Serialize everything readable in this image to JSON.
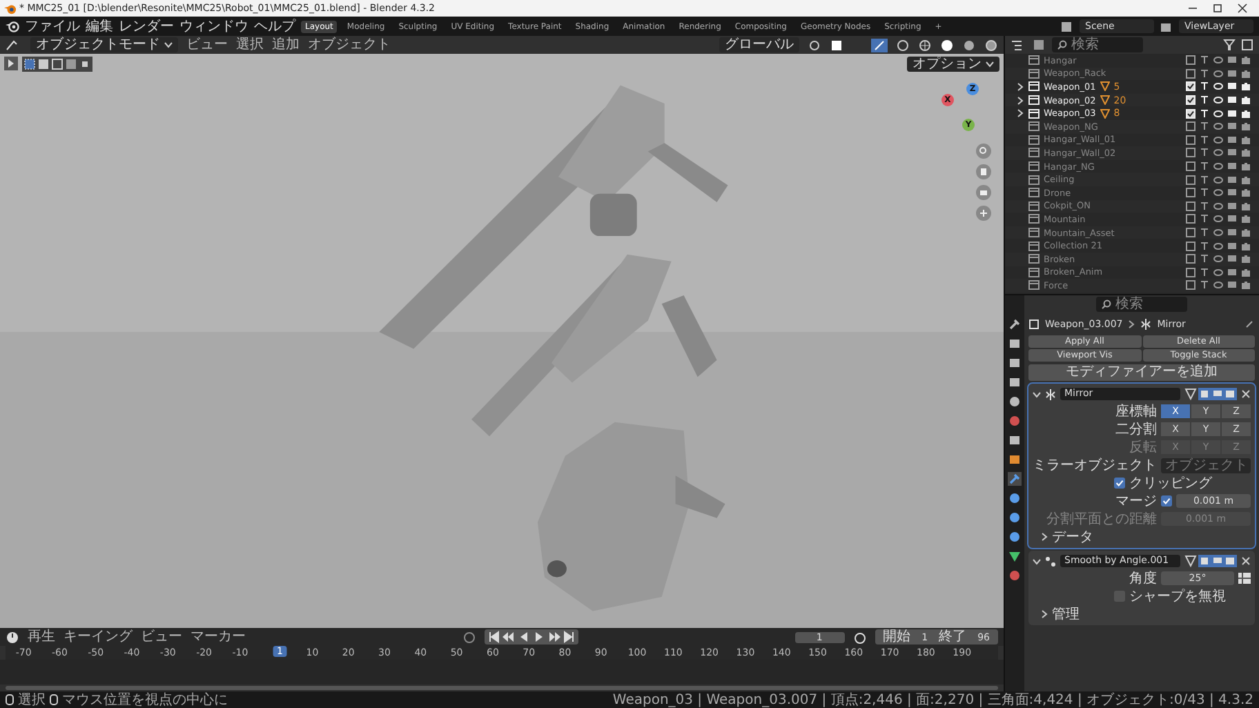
{
  "window": {
    "title": "* MMC25_01 [D:\\blender\\Resonite\\MMC25\\Robot_01\\MMC25_01.blend] - Blender 4.3.2"
  },
  "menu": [
    "ファイル",
    "編集",
    "レンダー",
    "ウィンドウ",
    "ヘルプ"
  ],
  "workspaces": [
    {
      "label": "Layout",
      "selected": true
    },
    {
      "label": "Modeling",
      "selected": false
    },
    {
      "label": "Sculpting",
      "selected": false
    },
    {
      "label": "UV Editing",
      "selected": false
    },
    {
      "label": "Texture Paint",
      "selected": false
    },
    {
      "label": "Shading",
      "selected": false
    },
    {
      "label": "Animation",
      "selected": false
    },
    {
      "label": "Rendering",
      "selected": false
    },
    {
      "label": "Compositing",
      "selected": false
    },
    {
      "label": "Geometry Nodes",
      "selected": false
    },
    {
      "label": "Scripting",
      "selected": false
    }
  ],
  "add_workspace": "+",
  "scene": "Scene",
  "view_layer": "ViewLayer",
  "viewport": {
    "mode": "オブジェクトモード",
    "menus": [
      "ビュー",
      "選択",
      "追加",
      "オブジェクト"
    ],
    "transform": "グローバル",
    "options": "オプション",
    "axes": [
      "X",
      "Y",
      "Z"
    ]
  },
  "outliner": {
    "search_placeholder": "検索",
    "items": [
      {
        "name": "Hangar",
        "enabled": false,
        "expandable": false
      },
      {
        "name": "Weapon_Rack",
        "enabled": false,
        "expandable": false
      },
      {
        "name": "Weapon_01",
        "enabled": true,
        "expandable": true,
        "count": "5"
      },
      {
        "name": "Weapon_02",
        "enabled": true,
        "expandable": true,
        "count": "20"
      },
      {
        "name": "Weapon_03",
        "enabled": true,
        "expandable": true,
        "count": "8"
      },
      {
        "name": "Weapon_NG",
        "enabled": false,
        "expandable": false
      },
      {
        "name": "Hangar_Wall_01",
        "enabled": false,
        "expandable": false
      },
      {
        "name": "Hangar_Wall_02",
        "enabled": false,
        "expandable": false
      },
      {
        "name": "Hangar_NG",
        "enabled": false,
        "expandable": false
      },
      {
        "name": "Ceiling",
        "enabled": false,
        "expandable": false
      },
      {
        "name": "Drone",
        "enabled": false,
        "expandable": false
      },
      {
        "name": "Cokpit_ON",
        "enabled": false,
        "expandable": false
      },
      {
        "name": "Mountain",
        "enabled": false,
        "expandable": false
      },
      {
        "name": "Mountain_Asset",
        "enabled": false,
        "expandable": false
      },
      {
        "name": "Collection 21",
        "enabled": false,
        "expandable": false
      },
      {
        "name": "Broken",
        "enabled": false,
        "expandable": false
      },
      {
        "name": "Broken_Anim",
        "enabled": false,
        "expandable": false
      },
      {
        "name": "Force",
        "enabled": false,
        "expandable": false
      }
    ]
  },
  "properties": {
    "search_placeholder": "検索",
    "object": "Weapon_03.007",
    "modifier_crumb": "Mirror",
    "buttons": [
      "Apply All",
      "Delete All",
      "Viewport Vis",
      "Toggle Stack"
    ],
    "add_modifier": "モディファイアーを追加",
    "mirror": {
      "name": "Mirror",
      "expanded": true,
      "axis_rows": [
        {
          "label": "座標軸",
          "disabled": false,
          "options": [
            {
              "label": "X",
              "selected": true
            },
            {
              "label": "Y",
              "selected": false
            },
            {
              "label": "Z",
              "selected": false
            }
          ]
        },
        {
          "label": "二分割",
          "disabled": false,
          "options": [
            {
              "label": "X",
              "selected": false
            },
            {
              "label": "Y",
              "selected": false
            },
            {
              "label": "Z",
              "selected": false
            }
          ]
        },
        {
          "label": "反転",
          "disabled": true,
          "options": [
            {
              "label": "X",
              "selected": false
            },
            {
              "label": "Y",
              "selected": false
            },
            {
              "label": "Z",
              "selected": false
            }
          ]
        }
      ],
      "mirror_object": {
        "label": "ミラーオブジェクト",
        "placeholder": "オブジェクト"
      },
      "clipping": {
        "label": "クリッピング",
        "checked": true
      },
      "merge": {
        "label": "マージ",
        "checked": true,
        "value": "0.001 m"
      },
      "bisect_distance": {
        "label": "分割平面との距離",
        "value": "0.001 m",
        "disabled": true
      },
      "subpanel": "データ"
    },
    "smooth": {
      "name": "Smooth by Angle.001",
      "expanded": true,
      "angle_label": "角度",
      "angle": "25°",
      "ignore_sharp": {
        "label": "シャープを無視",
        "checked": false
      },
      "subpanel": "管理"
    }
  },
  "timeline": {
    "menus": [
      "再生",
      "キーイング",
      "ビュー",
      "マーカー"
    ],
    "ticks": [
      "-70",
      "-60",
      "-50",
      "-40",
      "-30",
      "-20",
      "-10",
      "10",
      "20",
      "30",
      "40",
      "50",
      "60",
      "70",
      "80",
      "90",
      "100",
      "110",
      "120",
      "130",
      "140",
      "150",
      "160",
      "170",
      "180",
      "190"
    ],
    "current_frame": "1",
    "frame_field": "1",
    "start_label": "開始",
    "start": "1",
    "end_label": "終了",
    "end": "96"
  },
  "status": {
    "hints": [
      "選択",
      "マウス位置を視点の中心に"
    ],
    "stats": "Weapon_03 | Weapon_03.007 | 頂点:2,446 | 面:2,270 | 三角面:4,424 | オブジェクト:0/43 | 4.3.2"
  }
}
